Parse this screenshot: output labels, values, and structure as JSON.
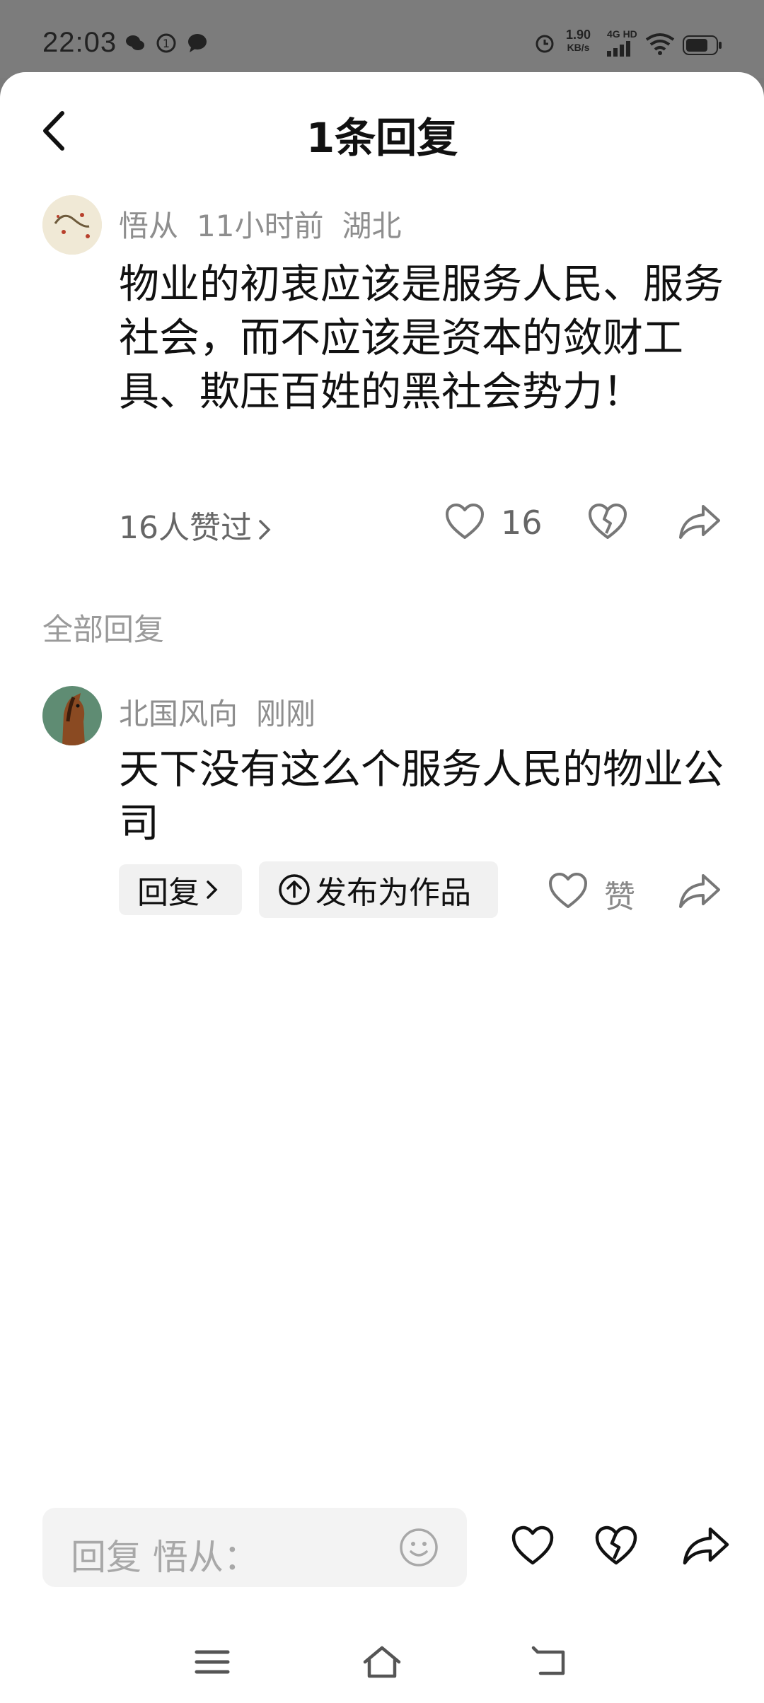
{
  "status_bar": {
    "time": "22:03",
    "net_speed_value": "1.90",
    "net_speed_unit": "KB/s",
    "network_type": "4G HD"
  },
  "header": {
    "title": "1条回复"
  },
  "main_comment": {
    "author": "悟从",
    "time": "11小时前",
    "location": "湖北",
    "text": "物业的初衷应该是服务人民、服务社会，而不应该是资本的敛财工具、欺压百姓的黑社会势力！",
    "likers_label": "16人赞过",
    "like_count": "16"
  },
  "section": {
    "label": "全部回复"
  },
  "reply": {
    "author": "北国风向",
    "time": "刚刚",
    "text": "天下没有这么个服务人民的物业公司",
    "reply_button": "回复",
    "publish_button": "发布为作品",
    "like_label": "赞"
  },
  "input": {
    "placeholder": "回复 悟从："
  },
  "colors": {
    "icon_gray": "#8e8e8e",
    "dark": "#111111"
  }
}
